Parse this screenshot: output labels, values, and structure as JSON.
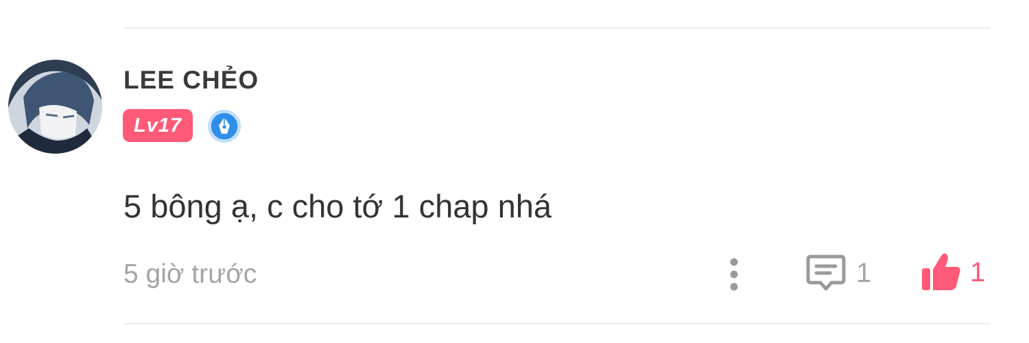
{
  "comment": {
    "username": "LEE CHẺO",
    "level_badge": "Lv17",
    "text": "5 bông ạ, c cho tớ 1 chap nhá",
    "timestamp": "5 giờ trước",
    "reply_count": "1",
    "like_count": "1"
  },
  "colors": {
    "accent": "#ff5a78",
    "badge_blue": "#2f8fe8",
    "muted_text": "#a4a4a4",
    "body_text": "#333333"
  },
  "icons": {
    "avatar": "avatar-image",
    "badge": "pen-nib-badge-icon",
    "more": "more-vertical-icon",
    "reply": "comment-bubble-icon",
    "like": "thumbs-up-icon"
  }
}
